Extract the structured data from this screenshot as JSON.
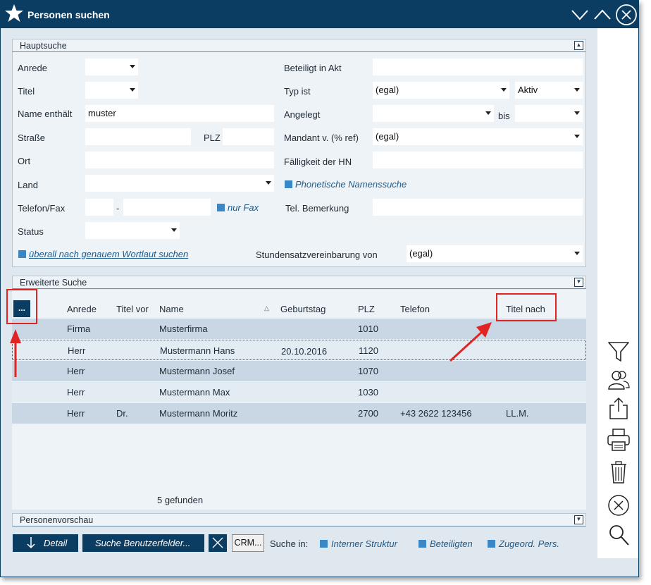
{
  "window": {
    "title": "Personen suchen"
  },
  "hauptsuche": {
    "title": "Hauptsuche",
    "anrede_label": "Anrede",
    "titel_label": "Titel",
    "name_label": "Name enthält",
    "name_value": "muster",
    "strasse_label": "Straße",
    "plz_label": "PLZ",
    "ort_label": "Ort",
    "land_label": "Land",
    "telefon_label": "Telefon/Fax",
    "telefon_sep": "-",
    "nur_fax_label": "nur Fax",
    "status_label": "Status",
    "wortlaut_label": "überall nach genauem Wortlaut suchen",
    "beteiligt_label": "Beteiligt in Akt",
    "typ_label": "Typ ist",
    "typ_value": "(egal)",
    "typ_status_value": "Aktiv",
    "angelegt_label": "Angelegt",
    "bis_label": "bis",
    "mandant_label": "Mandant v. (% ref)",
    "mandant_value": "(egal)",
    "faelligkeit_label": "Fälligkeit der HN",
    "phonetisch_label": "Phonetische Namenssuche",
    "tel_bemerkung_label": "Tel. Bemerkung",
    "stundensatz_label": "Stundensatzvereinbarung von",
    "stundensatz_value": "(egal)"
  },
  "erweitert": {
    "title": "Erweiterte Suche"
  },
  "table": {
    "menu_button": "...",
    "columns": {
      "anrede": "Anrede",
      "titel_vor": "Titel vor",
      "name": "Name",
      "geburtstag": "Geburtstag",
      "plz": "PLZ",
      "telefon": "Telefon",
      "titel_nach": "Titel nach"
    },
    "rows": [
      {
        "anrede": "Firma",
        "titel_vor": "",
        "name": "Musterfirma",
        "geburtstag": "",
        "plz": "1010",
        "telefon": "",
        "titel_nach": ""
      },
      {
        "anrede": "Herr",
        "titel_vor": "",
        "name": "Mustermann Hans",
        "geburtstag": "20.10.2016",
        "plz": "1120",
        "telefon": "",
        "titel_nach": ""
      },
      {
        "anrede": "Herr",
        "titel_vor": "",
        "name": "Mustermann Josef",
        "geburtstag": "",
        "plz": "1070",
        "telefon": "",
        "titel_nach": ""
      },
      {
        "anrede": "Herr",
        "titel_vor": "",
        "name": "Mustermann Max",
        "geburtstag": "",
        "plz": "1030",
        "telefon": "",
        "titel_nach": ""
      },
      {
        "anrede": "Herr",
        "titel_vor": "Dr.",
        "name": "Mustermann Moritz",
        "geburtstag": "",
        "plz": "2700",
        "telefon": "+43 2622 123456",
        "titel_nach": "LL.M."
      }
    ],
    "count_text": "5 gefunden"
  },
  "vorschau": {
    "title": "Personenvorschau"
  },
  "bottom": {
    "detail_label": "Detail",
    "benutzerfelder_label": "Suche Benutzerfelder...",
    "crm_label": "CRM...",
    "suche_in_label": "Suche in:",
    "interner_label": "Interner Struktur",
    "beteiligten_label": "Beteiligten",
    "zugeord_label": "Zugeord. Pers."
  },
  "colors": {
    "titlebar": "#0b3c61",
    "accent": "#3b86c4",
    "annotation": "#e02424"
  }
}
